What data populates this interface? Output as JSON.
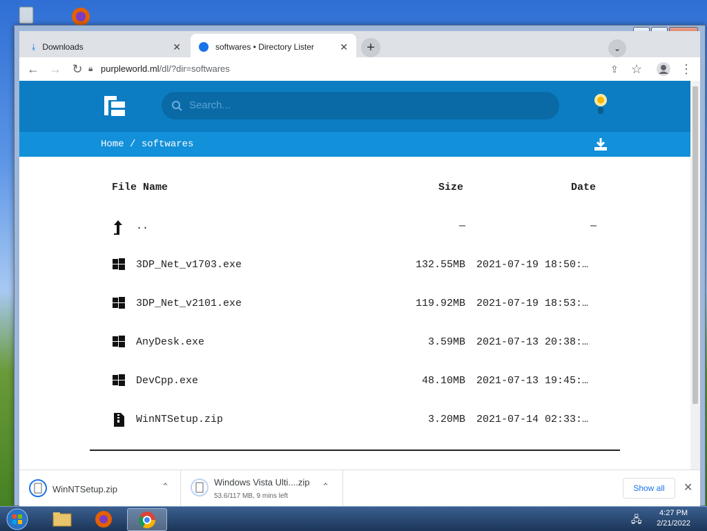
{
  "browser": {
    "tabs": [
      {
        "title": "Downloads",
        "icon": "download-icon"
      },
      {
        "title": "softwares • Directory Lister",
        "icon": "directory-lister-favicon"
      }
    ],
    "address": {
      "host": "purpleworld.ml",
      "path": "/dl/?dir=softwares"
    }
  },
  "page": {
    "search_placeholder": "Search...",
    "breadcrumb": {
      "home": "Home",
      "separator": "/",
      "current": "softwares"
    },
    "columns": {
      "name": "File Name",
      "size": "Size",
      "date": "Date"
    },
    "parent": {
      "name": "..",
      "size": "—",
      "date": "—"
    },
    "files": [
      {
        "name": "3DP_Net_v1703.exe",
        "size": "132.55MB",
        "date": "2021-07-19 18:50:…",
        "icon": "windows-icon"
      },
      {
        "name": "3DP_Net_v2101.exe",
        "size": "119.92MB",
        "date": "2021-07-19 18:53:…",
        "icon": "windows-icon"
      },
      {
        "name": "AnyDesk.exe",
        "size": "3.59MB",
        "date": "2021-07-13 20:38:…",
        "icon": "windows-icon"
      },
      {
        "name": "DevCpp.exe",
        "size": "48.10MB",
        "date": "2021-07-13 19:45:…",
        "icon": "windows-icon"
      },
      {
        "name": "WinNTSetup.zip",
        "size": "3.20MB",
        "date": "2021-07-14 02:33:…",
        "icon": "zip-file-icon"
      }
    ]
  },
  "downloads": {
    "items": [
      {
        "name": "WinNTSetup.zip",
        "status": ""
      },
      {
        "name": "Windows Vista Ulti....zip",
        "status": "53.6/117 MB, 9 mins left"
      }
    ],
    "show_all": "Show all"
  },
  "taskbar": {
    "time": "4:27 PM",
    "date": "2/21/2022"
  },
  "colors": {
    "header": "#0c7dc3",
    "breadcrumb_bar": "#1290d9",
    "link": "#1a73e8"
  }
}
